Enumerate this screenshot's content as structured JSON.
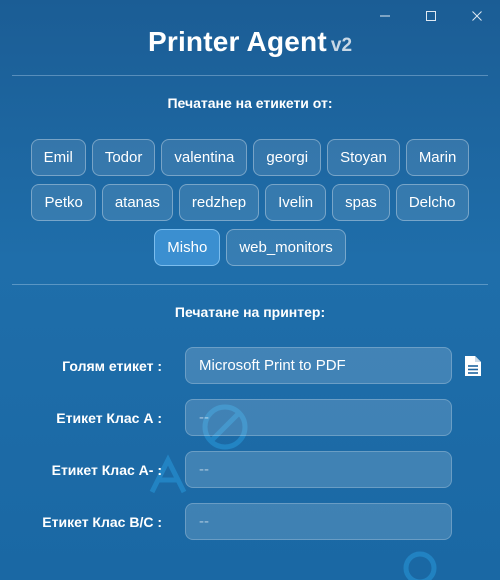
{
  "window": {
    "controls": [
      "minimize",
      "maximize",
      "close"
    ]
  },
  "app": {
    "title": "Printer Agent",
    "version": "v2"
  },
  "labels_section": {
    "heading": "Печатане на етикети от:",
    "users": [
      [
        "Emil",
        "Todor",
        "valentina",
        "georgi",
        "Stoyan",
        "Marin"
      ],
      [
        "Petko",
        "atanas",
        "redzhep",
        "Ivelin",
        "spas",
        "Delcho"
      ],
      [
        "Misho",
        "web_monitors"
      ]
    ],
    "selected": "Misho"
  },
  "printer_section": {
    "heading": "Печатане на принтер:",
    "rows": [
      {
        "label": "Голям етикет :",
        "value": "Microsoft Print to PDF",
        "empty": false
      },
      {
        "label": "Етикет Клас А :",
        "value": "--",
        "empty": true
      },
      {
        "label": "Етикет Клас А- :",
        "value": "--",
        "empty": true
      },
      {
        "label": "Етикет Клас В/С :",
        "value": "--",
        "empty": true
      }
    ]
  },
  "colors": {
    "background_top": "#1b5d95",
    "background_bottom": "#1a68a4",
    "chip_selected": "#3b8fd0",
    "decor_accent": "#2aa3e6"
  },
  "icons": {
    "file": "document-icon",
    "minimize": "minimize-icon",
    "maximize": "maximize-icon",
    "close": "close-icon"
  }
}
